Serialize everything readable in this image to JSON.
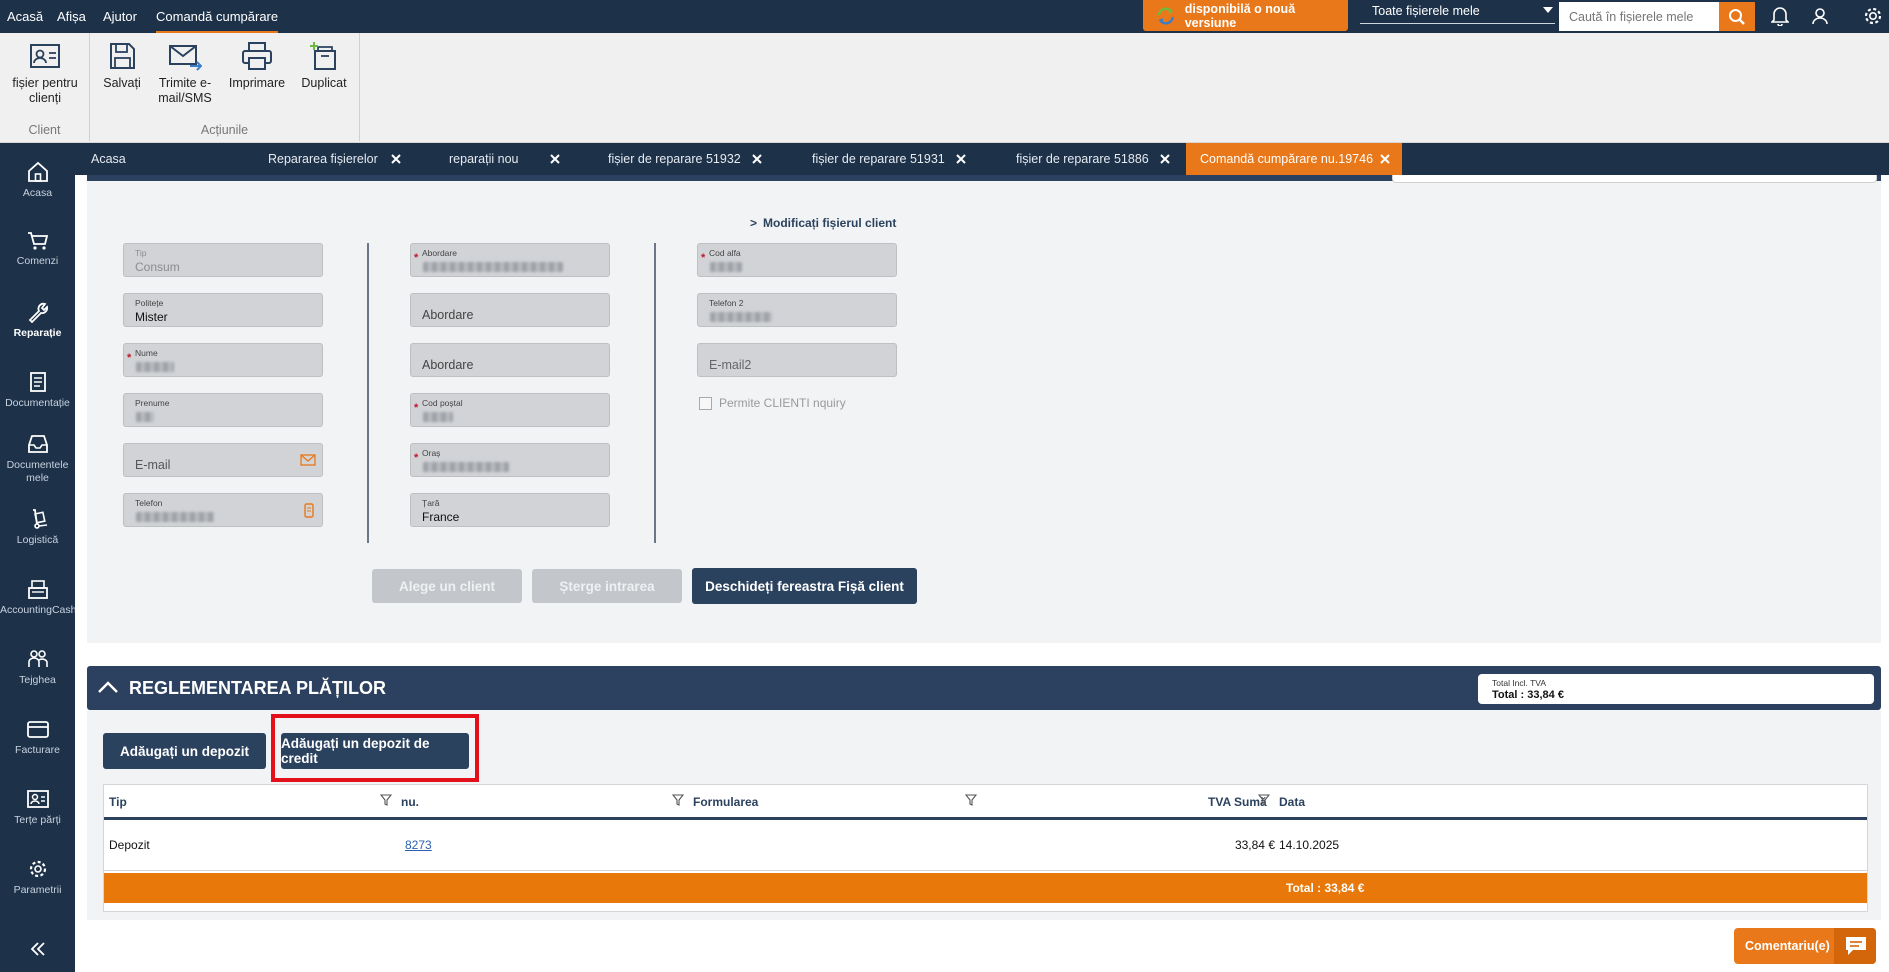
{
  "topmenu": {
    "items": [
      "Acasă",
      "Afișa",
      "Ajutor",
      "Comandă cumpărare"
    ],
    "update_label": "disponibilă o nouă versiune",
    "files_select": "Toate fișierele mele",
    "search_placeholder": "Caută în fișierele mele"
  },
  "ribbon": {
    "client_group": {
      "label": "Client",
      "btn": "fișier pentru clienți"
    },
    "actions_group": {
      "label": "Acțiunile",
      "btns": [
        "Salvați",
        "Trimite e-mail/SMS",
        "Imprimare",
        "Duplicat"
      ]
    }
  },
  "sidenav": {
    "items": [
      "Acasa",
      "Comenzi",
      "Reparație",
      "Documentație",
      "Documentele mele",
      "Logistică",
      "AccountingCash",
      "Tejghea",
      "Facturare",
      "Terțe părți",
      "Parametrii"
    ]
  },
  "tabs": [
    "Acasa",
    "Repararea fișierelor",
    "reparații nou",
    "fișier de reparare 51932",
    "fișier de reparare 51931",
    "fișier de reparare 51886",
    "Comandă cumpărare nu.19746"
  ],
  "client_form": {
    "edit_link": "Modificați fișierul client",
    "col1": {
      "tip": {
        "label": "Tip",
        "value": "Consum"
      },
      "politete": {
        "label": "Politețe",
        "value": "Mister"
      },
      "nume": {
        "label": "Nume"
      },
      "prenume": {
        "label": "Prenume"
      },
      "email": {
        "placeholder": "E-mail"
      },
      "telefon": {
        "label": "Telefon"
      }
    },
    "col2": {
      "abordare1": {
        "label": "Abordare"
      },
      "abordare2": {
        "placeholder": "Abordare"
      },
      "abordare3": {
        "placeholder": "Abordare"
      },
      "cod_postal": {
        "label": "Cod poștal"
      },
      "oras": {
        "label": "Oraș"
      },
      "tara": {
        "label": "Țară",
        "value": "France"
      }
    },
    "col3": {
      "cod_alfa": {
        "label": "Cod alfa"
      },
      "telefon2": {
        "label": "Telefon 2"
      },
      "email2": {
        "placeholder": "E-mail2"
      },
      "permite": "Permite CLIENTI nquiry"
    },
    "buttons": {
      "choose": "Alege un client",
      "delete": "Șterge intrarea",
      "open": "Deschideți fereastra Fișă client"
    }
  },
  "payments": {
    "title": "REGLEMENTAREA PLĂȚILOR",
    "total_label": "Total Incl. TVA",
    "total_value": "Total : 33,84 €",
    "btn_deposit": "Adăugați un depozit",
    "btn_credit": "Adăugați un depozit de credit",
    "columns": [
      "Tip",
      "nu.",
      "Formularea",
      "TVA Sumă",
      "Data"
    ],
    "rows": [
      {
        "tip": "Depozit",
        "nu": "8273",
        "formularea": "",
        "suma": "33,84 €",
        "data": "14.10.2025"
      }
    ],
    "footer_total": "Total : 33,84 €"
  },
  "comment_btn": "Comentariu(e)",
  "colors": {
    "navy": "#1d3149",
    "orange": "#e9781a",
    "highlight": "#e3101a"
  }
}
